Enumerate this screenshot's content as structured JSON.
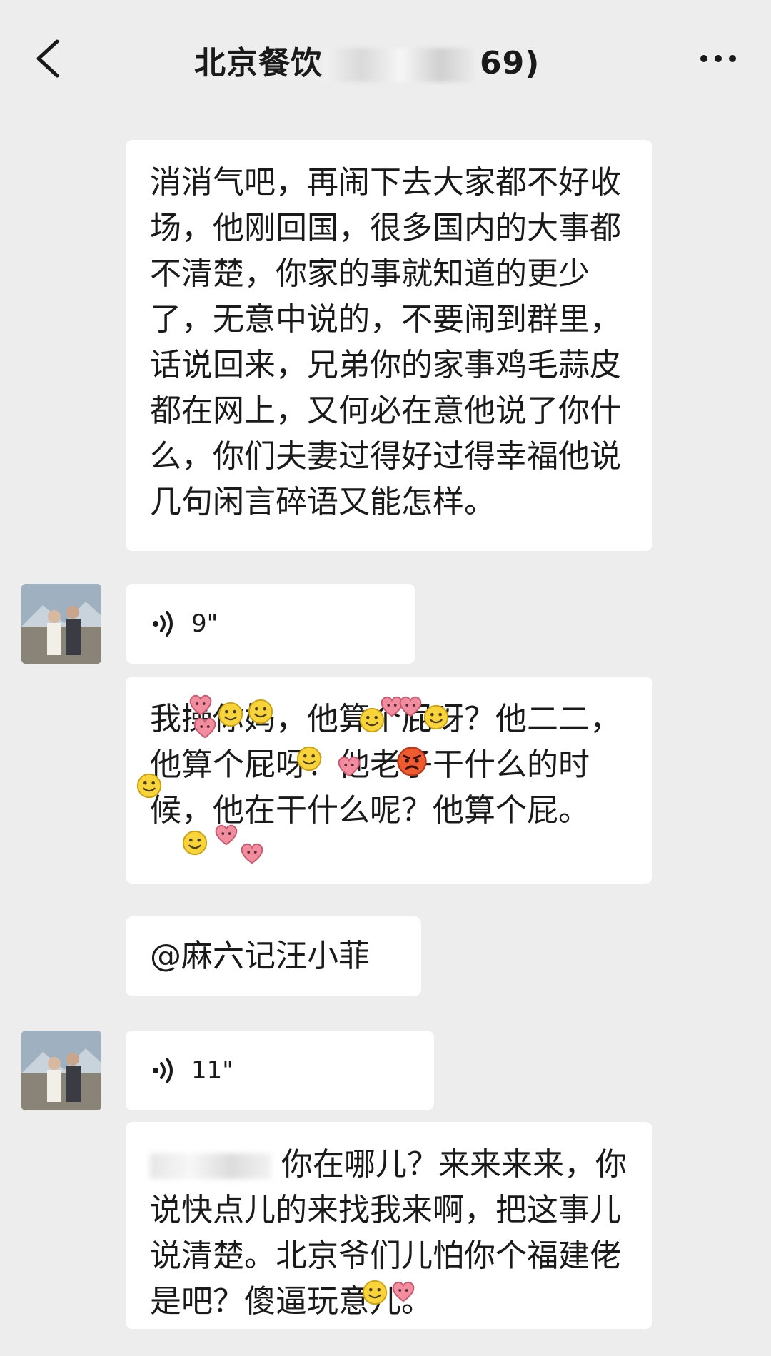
{
  "header": {
    "back_icon": "chevron-left-icon",
    "title_prefix": "北京餐饮",
    "title_suffix": "69)",
    "more_icon": "more-dots-icon"
  },
  "messages": {
    "m1_text": "消消气吧，再闹下去大家都不好收场，他刚回国，很多国内的大事都不清楚，你家的事就知道的更少了，无意中说的，不要闹到群里，话说回来，兄弟你的家事鸡毛蒜皮都在网上，又何必在意他说了你什么，你们夫妻过得好过得幸福他说几句闲言碎语又能怎样。",
    "voice1_duration": "9\"",
    "m3_text": "我操你妈，他算个屁呀？他二二，他算个屁呀？他老子干什么的时候，他在干什么呢？他算个屁。",
    "m4_text": "@麻六记汪小菲",
    "voice2_duration": "11\"",
    "m6_text": "你在哪儿？来来来来，你说快点儿的来找我来啊，把这事儿说清楚。北京爷们儿怕你个福建佬是吧？傻逼玩意儿。"
  },
  "icons": {
    "voice": "voice-wave-icon",
    "emoji_smile": "smile-emoji-icon",
    "emoji_heart": "heart-emoji-icon",
    "emoji_angry": "angry-emoji-icon"
  },
  "colors": {
    "background": "#ededed",
    "bubble": "#ffffff",
    "text": "#1a1a1a"
  }
}
